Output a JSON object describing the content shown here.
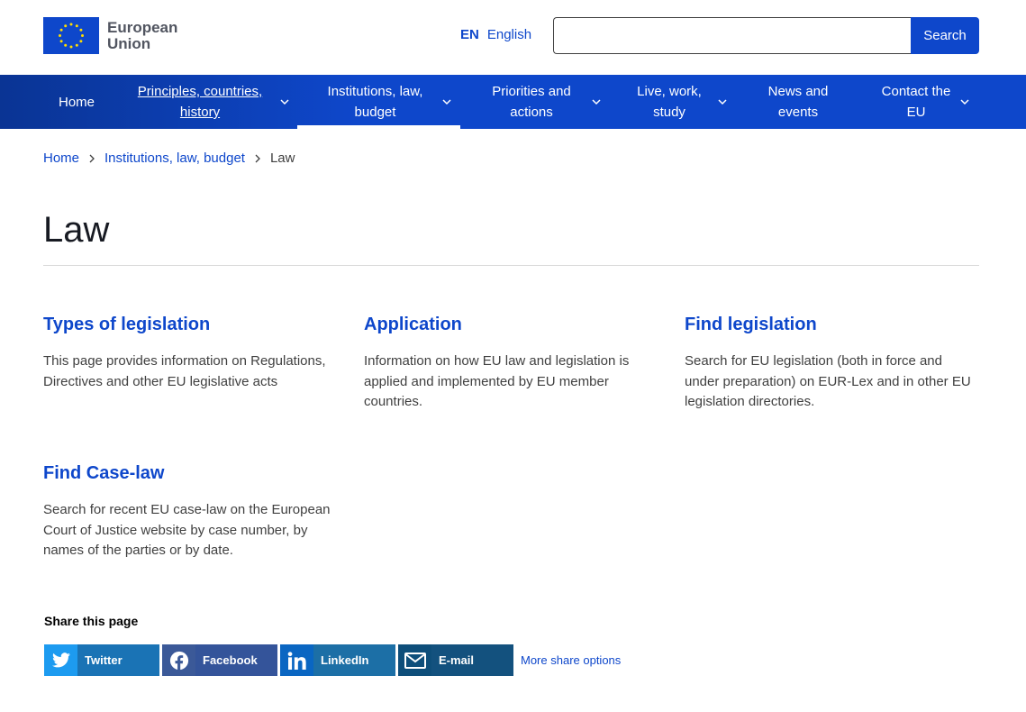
{
  "header": {
    "logo_line1": "European",
    "logo_line2": "Union",
    "lang_code": "EN",
    "lang_name": "English",
    "search_placeholder": "",
    "search_button": "Search"
  },
  "nav": {
    "items": [
      {
        "label": "Home"
      },
      {
        "label": "Principles, countries, history"
      },
      {
        "label": "Institutions, law, budget"
      },
      {
        "label": "Priorities and actions"
      },
      {
        "label": "Live, work, study"
      },
      {
        "label": "News and events"
      },
      {
        "label": "Contact the EU"
      }
    ]
  },
  "breadcrumb": {
    "items": [
      "Home",
      "Institutions, law, budget"
    ],
    "current": "Law"
  },
  "page": {
    "title": "Law"
  },
  "cards": [
    {
      "title": "Types of legislation",
      "text": "This page provides information on Regulations, Directives and other EU legislative acts"
    },
    {
      "title": "Application",
      "text": "Information on how EU law and legislation is applied and implemented by EU member countries."
    },
    {
      "title": "Find legislation",
      "text": "Search for EU legislation (both in force and under preparation) on EUR-Lex and in other EU legislation directories."
    },
    {
      "title": "Find Case-law",
      "text": "Search for recent EU case-law on the European Court of Justice website by case number, by names of the parties or by date."
    }
  ],
  "share": {
    "label": "Share this page",
    "buttons": [
      {
        "label": "Twitter",
        "icon": "twitter-icon",
        "color": "#1d9bf0",
        "bg": "#1a73b5"
      },
      {
        "label": "Facebook",
        "icon": "facebook-icon",
        "color": "#3b5998",
        "bg": "#34549a"
      },
      {
        "label": "LinkedIn",
        "icon": "linkedin-icon",
        "color": "#0a66c2",
        "bg": "#1c6fa6"
      },
      {
        "label": "E-mail",
        "icon": "email-icon",
        "color": "#0e4e7a",
        "bg": "#13517e"
      }
    ],
    "more": "More share options"
  },
  "colors": {
    "primary": "#0e47cb",
    "nav_dark": "#0a3494",
    "text": "#404040"
  }
}
